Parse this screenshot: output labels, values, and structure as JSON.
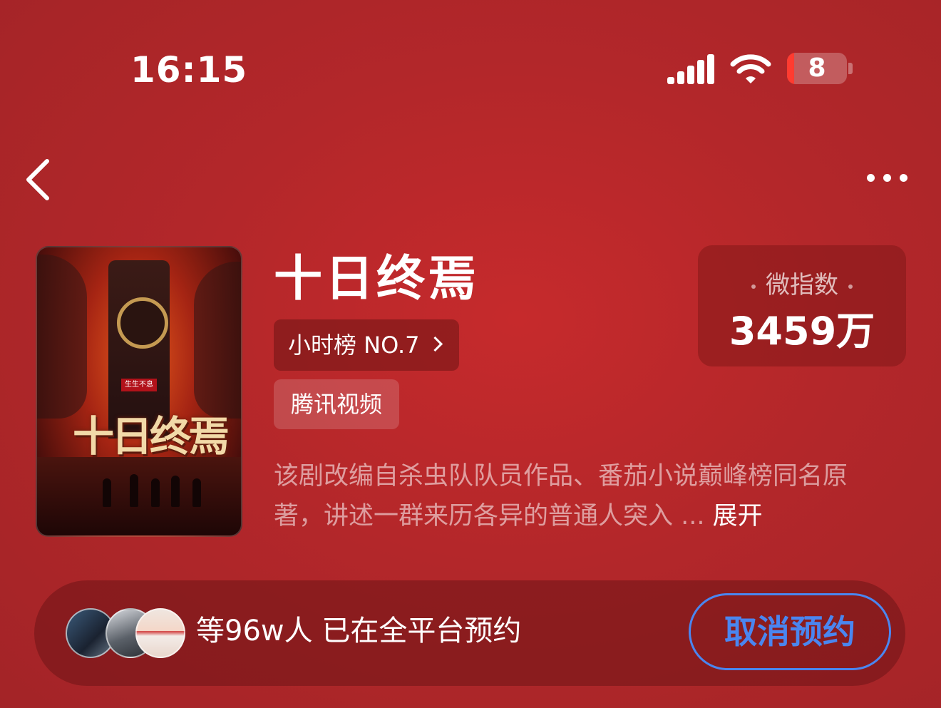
{
  "status_bar": {
    "time": "16:15",
    "battery": "8"
  },
  "nav": {
    "back_icon": "chevron-left-icon",
    "more_icon": "ellipsis-icon"
  },
  "show": {
    "title": "十日终焉",
    "rank_label": "小时榜 NO.7",
    "platform": "腾讯视频",
    "index_label": "微指数",
    "index_value": "3459万",
    "description": "该剧改编自杀虫队队员作品、番茄小说巅峰榜同名原著，讲述一群来历各异的普通人突入 ...",
    "expand_label": "展开",
    "poster_sign": "生生不息",
    "poster_title": "十日终焉"
  },
  "reservation": {
    "text": "等96w人 已在全平台预约",
    "cancel_label": "取消预约",
    "accent_color": "#4a86f0"
  },
  "colors": {
    "background": "#b3272a",
    "battery_low": "#ff3b30"
  }
}
